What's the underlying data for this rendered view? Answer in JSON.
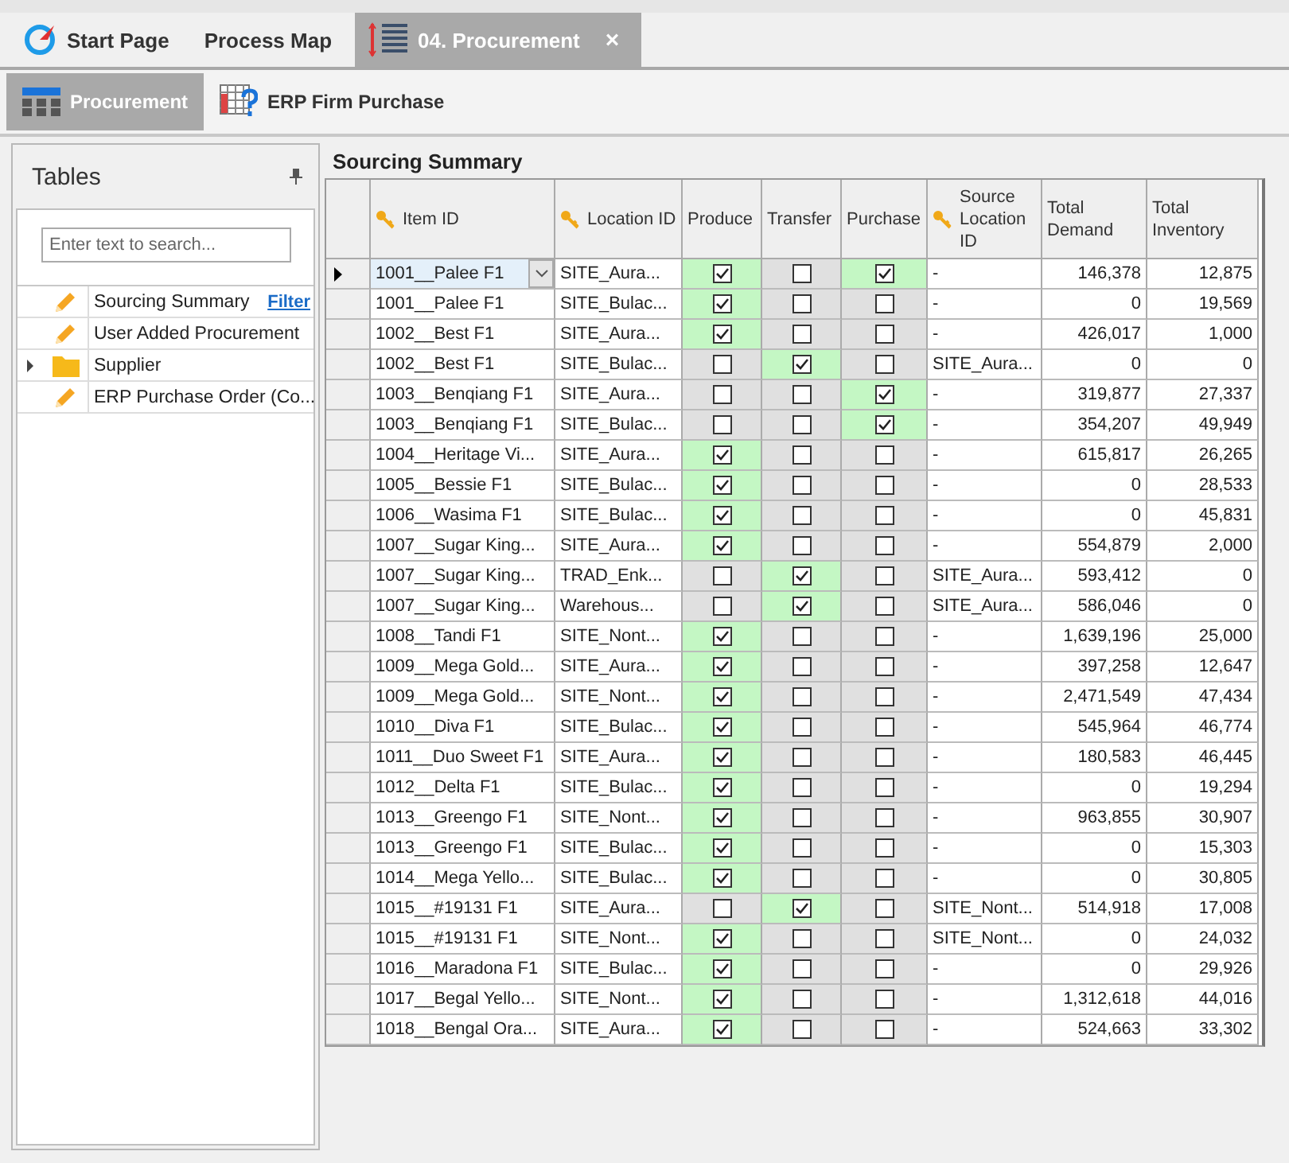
{
  "tabs": [
    {
      "label": "Start Page",
      "selected": false
    },
    {
      "label": "Process Map",
      "selected": false
    },
    {
      "label": "04. Procurement",
      "selected": true,
      "close": "×"
    }
  ],
  "toolbar": [
    {
      "label": "Procurement",
      "selected": true
    },
    {
      "label": "ERP Firm Purchase",
      "selected": false
    }
  ],
  "tables_panel": {
    "title": "Tables",
    "search": {
      "placeholder": "Enter text to search..."
    },
    "items": [
      {
        "label": "Sourcing Summary",
        "kind": "pencil",
        "link": "Filter"
      },
      {
        "label": "User Added Procurement",
        "kind": "pencil"
      },
      {
        "label": "Supplier",
        "kind": "folder",
        "expanded": false
      },
      {
        "label": "ERP Purchase Order (Co...",
        "kind": "pencil"
      }
    ]
  },
  "grid": {
    "title": "Sourcing Summary",
    "columns": [
      {
        "label": "Item ID",
        "key": true,
        "kind": "text"
      },
      {
        "label": "Location ID",
        "key": true,
        "kind": "text"
      },
      {
        "label": "Produce",
        "key": false,
        "kind": "check"
      },
      {
        "label": "Transfer",
        "key": false,
        "kind": "check"
      },
      {
        "label": "Purchase",
        "key": false,
        "kind": "check"
      },
      {
        "label": "Source Location ID",
        "key": true,
        "kind": "text"
      },
      {
        "label": "Total Demand",
        "key": false,
        "kind": "number"
      },
      {
        "label": "Total Inventory",
        "key": false,
        "kind": "number"
      }
    ],
    "rows": [
      {
        "selected": true,
        "cells": [
          "1001__Palee F1",
          "SITE_Aura...",
          true,
          false,
          true,
          "-",
          "146,378",
          "12,875"
        ]
      },
      {
        "selected": false,
        "cells": [
          "1001__Palee F1",
          "SITE_Bulac...",
          true,
          false,
          false,
          "-",
          "0",
          "19,569"
        ]
      },
      {
        "selected": false,
        "cells": [
          "1002__Best F1",
          "SITE_Aura...",
          true,
          false,
          false,
          "-",
          "426,017",
          "1,000"
        ]
      },
      {
        "selected": false,
        "cells": [
          "1002__Best F1",
          "SITE_Bulac...",
          false,
          true,
          false,
          "SITE_Aura...",
          "0",
          "0"
        ]
      },
      {
        "selected": false,
        "cells": [
          "1003__Benqiang F1",
          "SITE_Aura...",
          false,
          false,
          true,
          "-",
          "319,877",
          "27,337"
        ]
      },
      {
        "selected": false,
        "cells": [
          "1003__Benqiang F1",
          "SITE_Bulac...",
          false,
          false,
          true,
          "-",
          "354,207",
          "49,949"
        ]
      },
      {
        "selected": false,
        "cells": [
          "1004__Heritage Vi...",
          "SITE_Aura...",
          true,
          false,
          false,
          "-",
          "615,817",
          "26,265"
        ]
      },
      {
        "selected": false,
        "cells": [
          "1005__Bessie F1",
          "SITE_Bulac...",
          true,
          false,
          false,
          "-",
          "0",
          "28,533"
        ]
      },
      {
        "selected": false,
        "cells": [
          "1006__Wasima F1",
          "SITE_Bulac...",
          true,
          false,
          false,
          "-",
          "0",
          "45,831"
        ]
      },
      {
        "selected": false,
        "cells": [
          "1007__Sugar King...",
          "SITE_Aura...",
          true,
          false,
          false,
          "-",
          "554,879",
          "2,000"
        ]
      },
      {
        "selected": false,
        "cells": [
          "1007__Sugar King...",
          "TRAD_Enk...",
          false,
          true,
          false,
          "SITE_Aura...",
          "593,412",
          "0"
        ]
      },
      {
        "selected": false,
        "cells": [
          "1007__Sugar King...",
          "Warehous...",
          false,
          true,
          false,
          "SITE_Aura...",
          "586,046",
          "0"
        ]
      },
      {
        "selected": false,
        "cells": [
          "1008__Tandi F1",
          "SITE_Nont...",
          true,
          false,
          false,
          "-",
          "1,639,196",
          "25,000"
        ]
      },
      {
        "selected": false,
        "cells": [
          "1009__Mega Gold...",
          "SITE_Aura...",
          true,
          false,
          false,
          "-",
          "397,258",
          "12,647"
        ]
      },
      {
        "selected": false,
        "cells": [
          "1009__Mega Gold...",
          "SITE_Nont...",
          true,
          false,
          false,
          "-",
          "2,471,549",
          "47,434"
        ]
      },
      {
        "selected": false,
        "cells": [
          "1010__Diva F1",
          "SITE_Bulac...",
          true,
          false,
          false,
          "-",
          "545,964",
          "46,774"
        ]
      },
      {
        "selected": false,
        "cells": [
          "1011__Duo Sweet F1",
          "SITE_Aura...",
          true,
          false,
          false,
          "-",
          "180,583",
          "46,445"
        ]
      },
      {
        "selected": false,
        "cells": [
          "1012__Delta F1",
          "SITE_Bulac...",
          true,
          false,
          false,
          "-",
          "0",
          "19,294"
        ]
      },
      {
        "selected": false,
        "cells": [
          "1013__Greengo  F1",
          "SITE_Nont...",
          true,
          false,
          false,
          "-",
          "963,855",
          "30,907"
        ]
      },
      {
        "selected": false,
        "cells": [
          "1013__Greengo  F1",
          "SITE_Bulac...",
          true,
          false,
          false,
          "-",
          "0",
          "15,303"
        ]
      },
      {
        "selected": false,
        "cells": [
          "1014__Mega Yello...",
          "SITE_Bulac...",
          true,
          false,
          false,
          "-",
          "0",
          "30,805"
        ]
      },
      {
        "selected": false,
        "cells": [
          "1015__#19131 F1",
          "SITE_Aura...",
          false,
          true,
          false,
          "SITE_Nont...",
          "514,918",
          "17,008"
        ]
      },
      {
        "selected": false,
        "cells": [
          "1015__#19131 F1",
          "SITE_Nont...",
          true,
          false,
          false,
          "SITE_Nont...",
          "0",
          "24,032"
        ]
      },
      {
        "selected": false,
        "cells": [
          "1016__Maradona F1",
          "SITE_Bulac...",
          true,
          false,
          false,
          "-",
          "0",
          "29,926"
        ]
      },
      {
        "selected": false,
        "cells": [
          "1017__Begal Yello...",
          "SITE_Nont...",
          true,
          false,
          false,
          "-",
          "1,312,618",
          "44,016"
        ]
      },
      {
        "selected": false,
        "cells": [
          "1018__Bengal Ora...",
          "SITE_Aura...",
          true,
          false,
          false,
          "-",
          "524,663",
          "33,302"
        ]
      }
    ]
  }
}
